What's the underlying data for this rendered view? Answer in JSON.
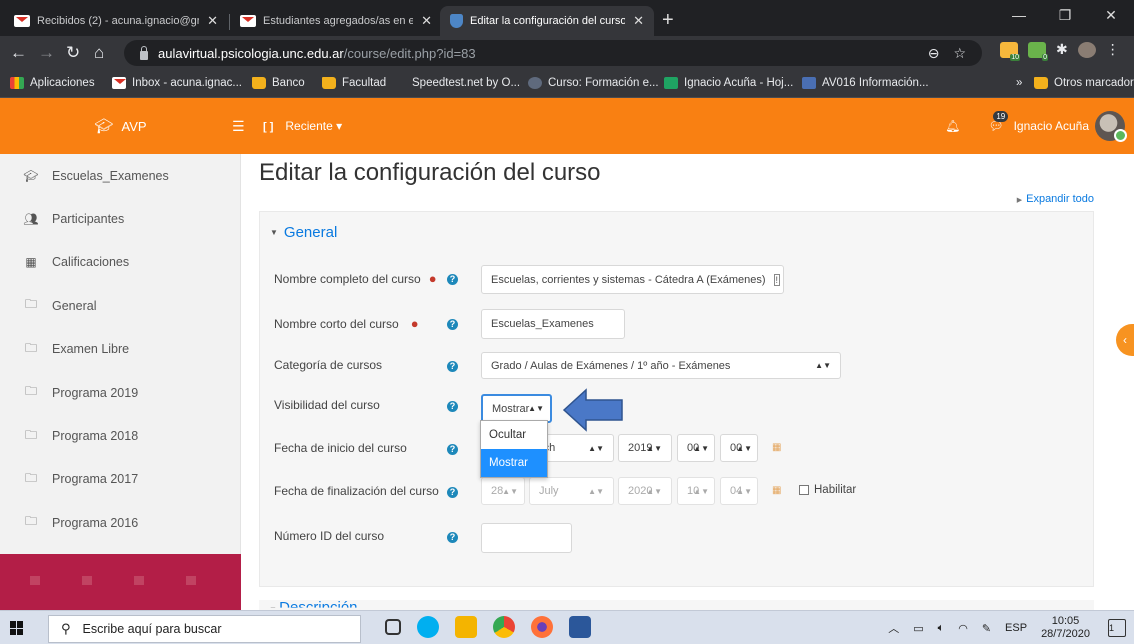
{
  "browser": {
    "tabs": [
      {
        "title": "Recibidos (2) - acuna.ignacio@gr",
        "active": false
      },
      {
        "title": "Estudiantes agregados/as en esp",
        "active": false
      },
      {
        "title": "Editar la configuración del curso",
        "active": true
      }
    ],
    "new_tab": "+",
    "url_host": "aulavirtual.psicologia.unc.edu.ar",
    "url_path": "/course/edit.php?id=83",
    "extension_badges": [
      "10",
      "0"
    ],
    "bookmarks": [
      "Aplicaciones",
      "Inbox - acuna.ignac...",
      "Banco",
      "Facultad",
      "Speedtest.net by O...",
      "Curso: Formación e...",
      "Ignacio Acuña - Hoj...",
      "AV016 Información..."
    ],
    "bookmarks_overflow": "»",
    "other_bookmarks": "Otros marcadores"
  },
  "header": {
    "brand": "AVP",
    "recent": "Reciente",
    "message_count": "19",
    "user_name": "Ignacio Acuña"
  },
  "sidebar": {
    "items": [
      {
        "label": "Escuelas_Examenes",
        "icon": "graduation-cap-icon"
      },
      {
        "label": "Participantes",
        "icon": "users-icon"
      },
      {
        "label": "Calificaciones",
        "icon": "table-icon"
      },
      {
        "label": "General",
        "icon": "folder-icon"
      },
      {
        "label": "Examen Libre",
        "icon": "folder-icon"
      },
      {
        "label": "Programa 2019",
        "icon": "folder-icon"
      },
      {
        "label": "Programa 2018",
        "icon": "folder-icon"
      },
      {
        "label": "Programa 2017",
        "icon": "folder-icon"
      },
      {
        "label": "Programa 2016",
        "icon": "folder-icon"
      }
    ]
  },
  "main": {
    "title": "Editar la configuración del curso",
    "expand_all": "Expandir todo",
    "section": "General",
    "fields": {
      "fullname_label": "Nombre completo del curso",
      "fullname_value": "Escuelas, corrientes y sistemas - Cátedra A (Exámenes)",
      "shortname_label": "Nombre corto del curso",
      "shortname_value": "Escuelas_Examenes",
      "category_label": "Categoría de cursos",
      "category_value": "Grado / Aulas de Exámenes / 1º año - Exámenes",
      "visibility_label": "Visibilidad del curso",
      "visibility_value": "Mostrar",
      "visibility_options": [
        "Ocultar",
        "Mostrar"
      ],
      "start_label": "Fecha de inicio del curso",
      "start_month_partial": "rch",
      "start_year": "2019",
      "start_hour": "00",
      "start_minute": "00",
      "end_label": "Fecha de finalización del curso",
      "end_day": "28",
      "end_month": "July",
      "end_year": "2020",
      "end_hour": "10",
      "end_minute": "04",
      "enable_label": "Habilitar",
      "idnumber_label": "Número ID del curso",
      "idnumber_value": ""
    },
    "next_section_partial": "Descripción"
  },
  "taskbar": {
    "search_placeholder": "Escribe aquí para buscar",
    "language": "ESP",
    "time": "10:05",
    "date": "28/7/2020",
    "notifications": "1"
  }
}
